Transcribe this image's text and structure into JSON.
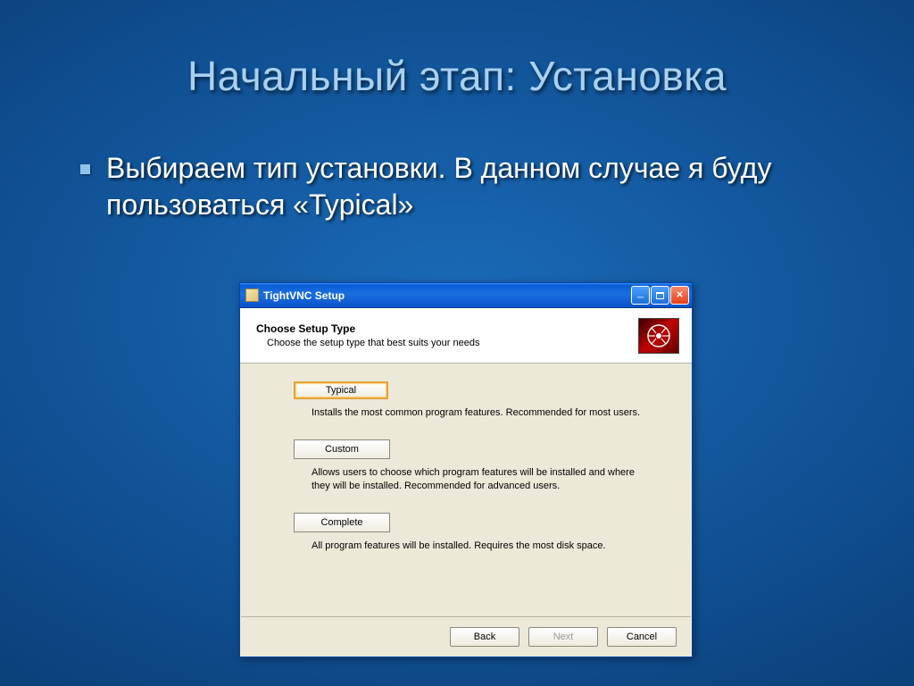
{
  "slide": {
    "title": "Начальный этап: Установка",
    "bullet": "Выбираем тип установки. В данном случае я буду пользоваться «Typical»"
  },
  "installer": {
    "window_title": "TightVNC Setup",
    "header": {
      "title": "Choose Setup Type",
      "subtitle": "Choose the setup type that best suits your needs"
    },
    "options": [
      {
        "label": "Typical",
        "desc": "Installs the most common program features. Recommended for most users.",
        "selected": true
      },
      {
        "label": "Custom",
        "desc": "Allows users to choose which program features will be installed and where they will be installed. Recommended for advanced users.",
        "selected": false
      },
      {
        "label": "Complete",
        "desc": "All program features will be installed. Requires the most disk space.",
        "selected": false
      }
    ],
    "buttons": {
      "back": "Back",
      "next": "Next",
      "cancel": "Cancel"
    }
  }
}
